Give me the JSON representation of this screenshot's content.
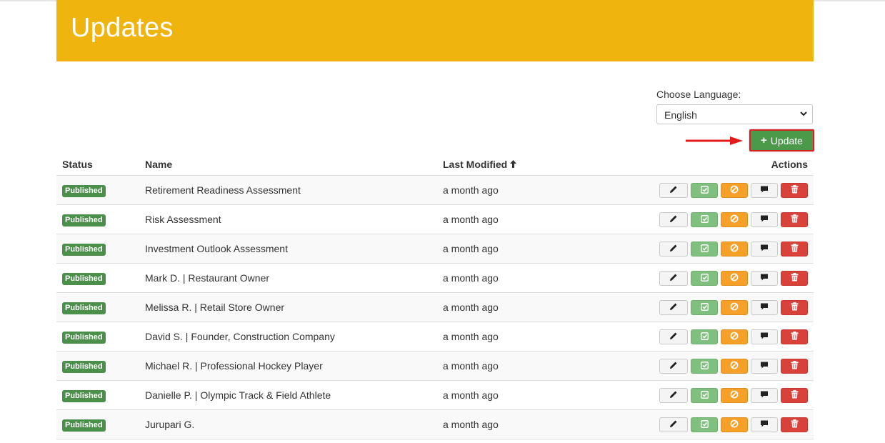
{
  "page": {
    "title": "Updates"
  },
  "language": {
    "label": "Choose Language:",
    "selected": "English"
  },
  "toolbar": {
    "add_icon": "+",
    "add_label": "Update"
  },
  "table": {
    "headers": {
      "status": "Status",
      "name": "Name",
      "last_modified": "Last Modified",
      "sort_icon": "🠕",
      "actions": "Actions"
    },
    "rows": [
      {
        "status": "Published",
        "name": "Retirement Readiness Assessment",
        "modified": "a month ago"
      },
      {
        "status": "Published",
        "name": "Risk Assessment",
        "modified": "a month ago"
      },
      {
        "status": "Published",
        "name": "Investment Outlook Assessment",
        "modified": "a month ago"
      },
      {
        "status": "Published",
        "name": "Mark D. | Restaurant Owner",
        "modified": "a month ago"
      },
      {
        "status": "Published",
        "name": "Melissa R. | Retail Store Owner",
        "modified": "a month ago"
      },
      {
        "status": "Published",
        "name": "David S. | Founder, Construction Company",
        "modified": "a month ago"
      },
      {
        "status": "Published",
        "name": "Michael R. | Professional Hockey Player",
        "modified": "a month ago"
      },
      {
        "status": "Published",
        "name": "Danielle P. | Olympic Track & Field Athlete",
        "modified": "a month ago"
      },
      {
        "status": "Published",
        "name": "Jurupari G.",
        "modified": "a month ago"
      }
    ]
  },
  "action_icons": {
    "edit": "pencil-icon",
    "publish": "check-square-icon",
    "unpublish": "ban-icon",
    "comments": "comment-icon",
    "delete": "trash-icon"
  },
  "colors": {
    "banner": "#f0b40f",
    "published_badge": "#4a8f4a",
    "add_button": "#4a9a4a",
    "highlight": "#d62020"
  }
}
